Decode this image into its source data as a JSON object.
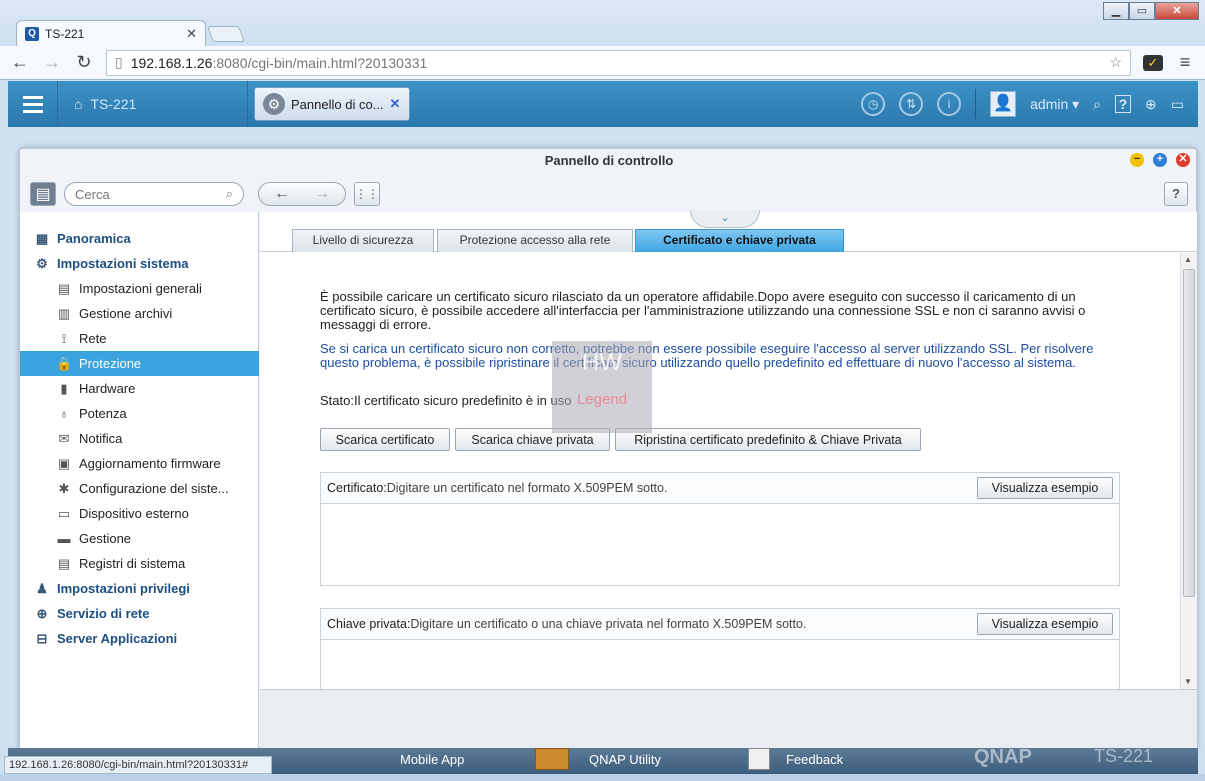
{
  "browser": {
    "tab_title": "TS-221",
    "tab_favicon": "Q",
    "url_host": "192.168.1.26",
    "url_rest": ":8080/cgi-bin/main.html?20130331",
    "status_text": "192.168.1.26:8080/cgi-bin/main.html?20130331#"
  },
  "qnap_bar": {
    "home_label": "TS-221",
    "app_tab_label": "Pannello di co...",
    "user": "admin"
  },
  "window": {
    "title": "Pannello di controllo",
    "search_placeholder": "Cerca"
  },
  "sidebar": {
    "items": [
      {
        "label": "Panoramica",
        "icon": "grid-icon",
        "level": "top"
      },
      {
        "label": "Impostazioni sistema",
        "icon": "gear-icon",
        "level": "top"
      },
      {
        "label": "Impostazioni generali",
        "icon": "settings-doc-icon",
        "level": "sub"
      },
      {
        "label": "Gestione archivi",
        "icon": "storage-icon",
        "level": "sub"
      },
      {
        "label": "Rete",
        "icon": "network-icon",
        "level": "sub"
      },
      {
        "label": "Protezione",
        "icon": "lock-icon",
        "level": "sub",
        "selected": true
      },
      {
        "label": "Hardware",
        "icon": "hardware-icon",
        "level": "sub"
      },
      {
        "label": "Potenza",
        "icon": "bulb-icon",
        "level": "sub"
      },
      {
        "label": "Notifica",
        "icon": "notification-icon",
        "level": "sub"
      },
      {
        "label": "Aggiornamento firmware",
        "icon": "firmware-icon",
        "level": "sub"
      },
      {
        "label": "Configurazione del siste...",
        "icon": "config-gear-icon",
        "level": "sub"
      },
      {
        "label": "Dispositivo esterno",
        "icon": "external-drive-icon",
        "level": "sub"
      },
      {
        "label": "Gestione",
        "icon": "monitor-icon",
        "level": "sub"
      },
      {
        "label": "Registri di sistema",
        "icon": "log-icon",
        "level": "sub"
      },
      {
        "label": "Impostazioni privilegi",
        "icon": "user-icon",
        "level": "top"
      },
      {
        "label": "Servizio di rete",
        "icon": "globe-icon",
        "level": "top"
      },
      {
        "label": "Server Applicazioni",
        "icon": "server-icon",
        "level": "top"
      }
    ]
  },
  "tabs": [
    {
      "label": "Livello di sicurezza"
    },
    {
      "label": "Protezione accesso alla rete"
    },
    {
      "label": "Certificato e chiave privata",
      "active": true
    }
  ],
  "content": {
    "intro": "È possibile caricare un certificato sicuro rilasciato da un operatore affidabile.Dopo avere eseguito con successo il caricamento di un certificato sicuro, è possibile accedere all'interfaccia per l'amministrazione utilizzando una connessione SSL e non ci saranno avvisi o messaggi di errore.",
    "warning": "Se si carica un certificato sicuro non corretto, potrebbe non essere possibile eseguire l'accesso al server utilizzando SSL. Per risolvere questo problema, è possibile ripristinare il certificato sicuro utilizzando quello predefinito ed effettuare di nuovo l'accesso al sistema.",
    "status": "Stato:Il certificato sicuro predefinito è in uso",
    "btn_download_cert": "Scarica certificato",
    "btn_download_key": "Scarica chiave privata",
    "btn_restore": "Ripristina certificato predefinito & Chiave Privata",
    "cert_label": "Certificato:",
    "cert_hint": "Digitare un certificato nel formato X.509PEM sotto.",
    "key_label": "Chiave privata:",
    "key_hint": "Digitare un certificato o una chiave privata nel formato X.509PEM sotto.",
    "example_btn": "Visualizza esempio"
  },
  "desktop": {
    "items": [
      "Mobile App",
      "QNAP Utility",
      "Feedback"
    ],
    "brand": "QNAP",
    "model": "TS-221"
  },
  "watermark": {
    "line1": "HW",
    "line2": "Legend"
  }
}
